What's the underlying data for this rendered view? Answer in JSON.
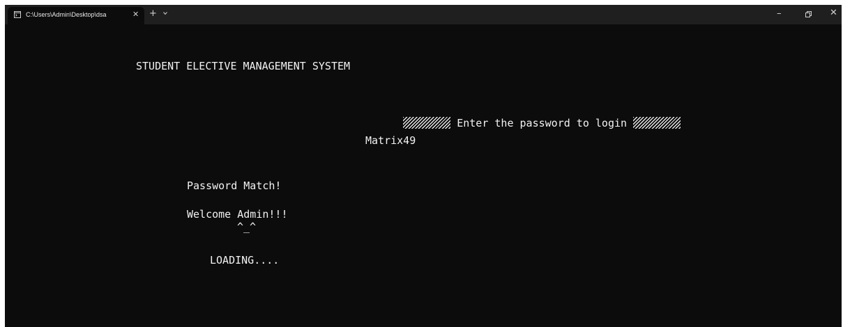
{
  "window": {
    "tab_title": "C:\\Users\\Admin\\Desktop\\dsa",
    "close_tab_glyph": "✕",
    "new_tab_glyph": "+",
    "minimize_glyph": "–",
    "close_window_glyph": "✕"
  },
  "console": {
    "heading": "STUDENT ELECTIVE MANAGEMENT SYSTEM",
    "prompt": " Enter the password to login ",
    "password_input": "Matrix49",
    "match_message": "Password Match!",
    "welcome_message": "Welcome Admin!!!",
    "emoticon": "^_^",
    "loading_message": "LOADING...."
  },
  "icons": [
    "terminal-icon",
    "close-icon",
    "plus-icon",
    "chevron-down-icon",
    "minimize-icon",
    "maximize-icon",
    "close-icon"
  ],
  "colors": {
    "console_bg": "#0c0c0c",
    "titlebar_bg": "#1f1f1f",
    "text": "#f2f2f2"
  }
}
